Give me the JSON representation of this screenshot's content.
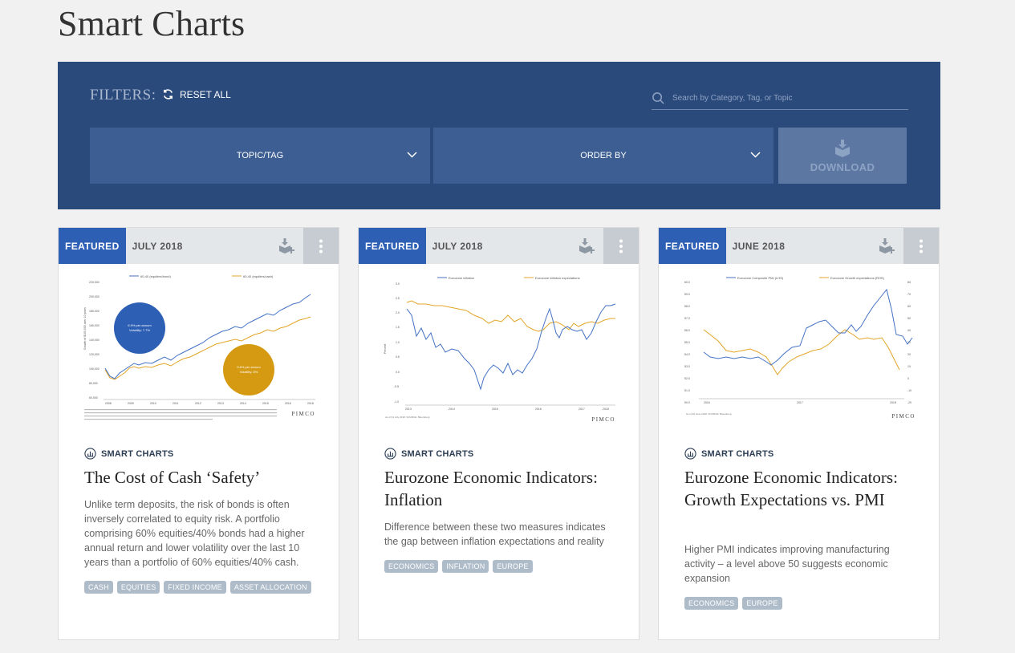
{
  "page": {
    "title": "Smart Charts"
  },
  "filters": {
    "label": "FILTERS:",
    "reset_label": "RESET ALL",
    "search_placeholder": "Search by Category, Tag, or Topic",
    "topic_label": "TOPIC/TAG",
    "order_label": "ORDER BY",
    "download_label": "DOWNLOAD"
  },
  "colors": {
    "header_panel": "#2b4a7c",
    "dropdown": "#3c5e93",
    "featured_badge": "#2d5fb5",
    "line_blue": "#4472c4",
    "line_gold": "#e3a528"
  },
  "icons": {
    "reset": "refresh-icon",
    "search": "search-icon",
    "download": "download-box-icon",
    "dropdown": "chevron-down-icon",
    "save": "add-to-download-icon",
    "menu": "vertical-dots-icon",
    "category": "bar-chart-circle-icon"
  },
  "cards": [
    {
      "badge": "FEATURED",
      "date": "JULY 2018",
      "category": "SMART CHARTS",
      "title": "The Cost of Cash ‘Safety’",
      "description": "Unlike term deposits, the risk of bonds is often inversely correlated to equity risk. A portfolio comprising 60% equities/40% bonds had a higher annual return and lower volatility over the last 10 years than a portfolio of 60% equities/40% cash.",
      "tags": [
        "CASH",
        "EQUITIES",
        "FIXED INCOME",
        "ASSET ALLOCATION"
      ],
      "thumb": {
        "legend": [
          "60-40 (equities/bond)",
          "60-40 (equities/cash)"
        ],
        "bubble1": [
          "6.9% per annum",
          "Volatility: 7.7%"
        ],
        "bubble2": [
          "5.6% per annum",
          "Volatility: 8%"
        ],
        "yticks": [
          "220,000",
          "200,000",
          "180,000",
          "160,000",
          "140,000",
          "120,000",
          "100,000",
          "80,000",
          "60,000",
          "40,000"
        ],
        "xticks": [
          "2008",
          "2009",
          "2010",
          "2011",
          "2012",
          "2013",
          "2014",
          "2015",
          "2016",
          "2017",
          "2018"
        ],
        "ylabel": "Growth of $100,000 over 10 years",
        "logo": "PIMCO"
      }
    },
    {
      "badge": "FEATURED",
      "date": "JULY 2018",
      "category": "SMART CHARTS",
      "title": "Eurozone Economic Indicators: Inflation",
      "description": "Difference between these two measures indicates the gap between inflation expectations and reality",
      "tags": [
        "ECONOMICS",
        "INFLATION",
        "EUROPE"
      ],
      "thumb": {
        "legend": [
          "Eurozone inflation",
          "Eurozone inflation expectations"
        ],
        "yticks": [
          "3.0",
          "2.5",
          "2.0",
          "1.5",
          "1.0",
          "0.5",
          "0.0",
          "-0.5",
          "-1.0"
        ],
        "xticks": [
          "2013",
          "2014",
          "2015",
          "2016",
          "2017",
          "2018"
        ],
        "ylabel": "Percent",
        "source": "As of 31 July 2018. SOURCE: Bloomberg",
        "logo": "PIMCO"
      }
    },
    {
      "badge": "FEATURED",
      "date": "JUNE 2018",
      "category": "SMART CHARTS",
      "title": "Eurozone Economic Indicators: Growth Expectations vs. PMI",
      "description": "Higher PMI indicates improving manufacturing activity – a level above 50 suggests economic expansion",
      "tags": [
        "ECONOMICS",
        "EUROPE"
      ],
      "thumb": {
        "legend": [
          "Eurozone Composite PMI (LHS)",
          "Eurozone Growth expectations (RHS)"
        ],
        "yticks": [
          "60.0",
          "59.0",
          "58.0",
          "57.0",
          "56.0",
          "55.0",
          "54.0",
          "53.0",
          "52.0",
          "51.0",
          "50.0"
        ],
        "y2ticks": [
          "80",
          "70",
          "60",
          "50",
          "40",
          "30",
          "20",
          "10",
          "0",
          "-10",
          "-20"
        ],
        "xticks": [
          "2016",
          "2017",
          "2018"
        ],
        "source": "As of 30 June 2018. SOURCE: Bloomberg",
        "logo": "PIMCO"
      }
    }
  ]
}
